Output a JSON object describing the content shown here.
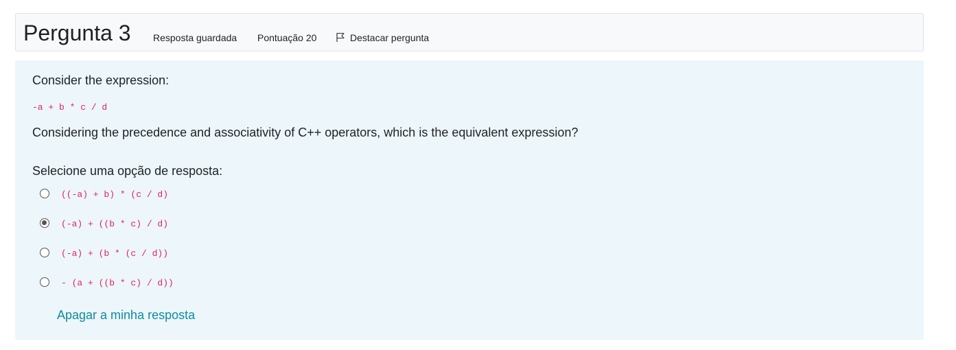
{
  "question": {
    "title_prefix": "Pergunta",
    "number": "3",
    "status": "Resposta guardada",
    "grade": "Pontuação 20",
    "flag_label": "Destacar pergunta",
    "flag_icon": "flag-icon"
  },
  "body": {
    "intro": "Consider the expression:",
    "expression": "-a + b * c / d",
    "prompt": "Considering the precedence and associativity of C++ operators, which is the equivalent expression?",
    "select_label": "Selecione uma opção de resposta:",
    "options": [
      {
        "text": "((-a) + b) * (c / d)",
        "checked": false
      },
      {
        "text": "(-a) + ((b * c) / d)",
        "checked": true
      },
      {
        "text": "(-a) + (b * (c / d))",
        "checked": false
      },
      {
        "text": "- (a + ((b * c) / d))",
        "checked": false
      }
    ],
    "clear_label": "Apagar a minha resposta"
  },
  "colors": {
    "code": "#e0245e",
    "link": "#0f8b9e",
    "content_bg": "#edf6fa",
    "header_bg": "#f8f9fa"
  }
}
